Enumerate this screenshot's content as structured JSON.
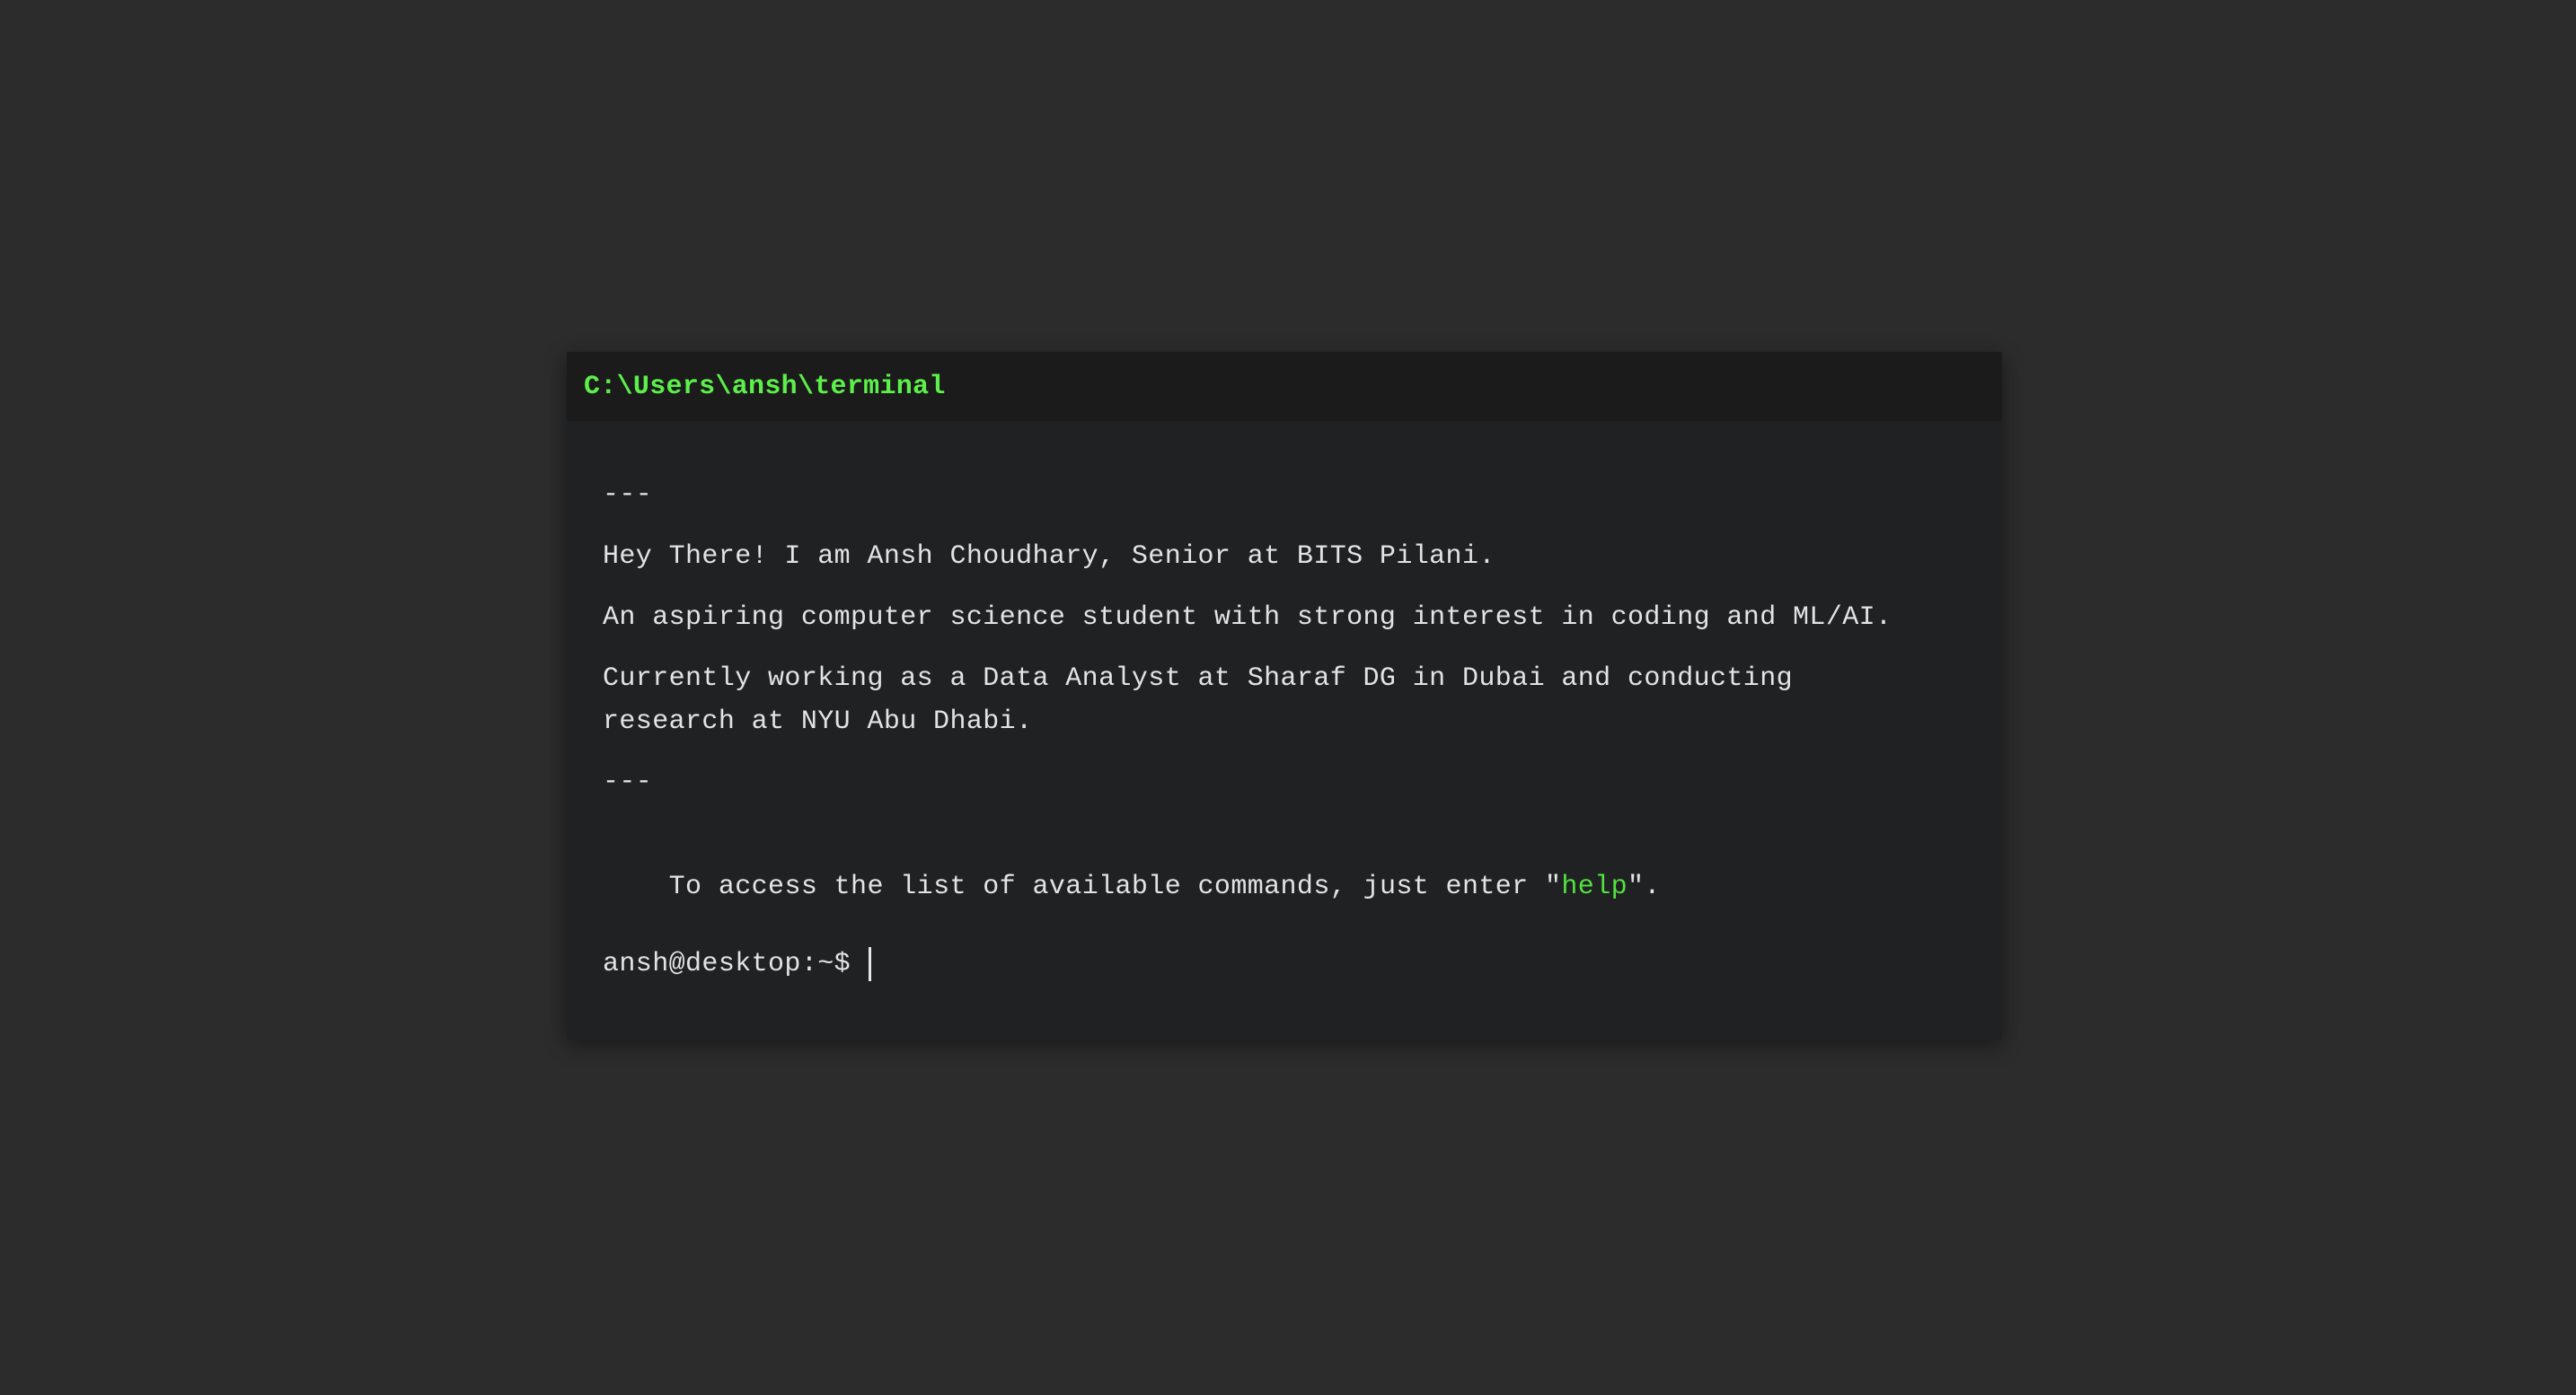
{
  "window": {
    "title": "C:\\Users\\ansh\\terminal"
  },
  "output": {
    "separator_top": "---",
    "intro": "Hey There! I am Ansh Choudhary, Senior at BITS Pilani.",
    "aspiration": "An aspiring computer science student with strong interest in coding and ML/AI.",
    "current_work": "Currently working as a Data Analyst at Sharaf DG in Dubai and conducting research at NYU Abu Dhabi.",
    "separator_bottom": "---",
    "help_prefix": "To access the list of available commands, just enter \"",
    "help_command": "help",
    "help_suffix": "\"."
  },
  "input": {
    "prompt": "ansh@desktop:~$",
    "value": ""
  },
  "colors": {
    "background": "#2c2c2c",
    "terminal_bg": "#202123",
    "title_bar_bg": "#1b1b1b",
    "accent_green": "#5cf04a",
    "text": "#e3e3e3"
  }
}
